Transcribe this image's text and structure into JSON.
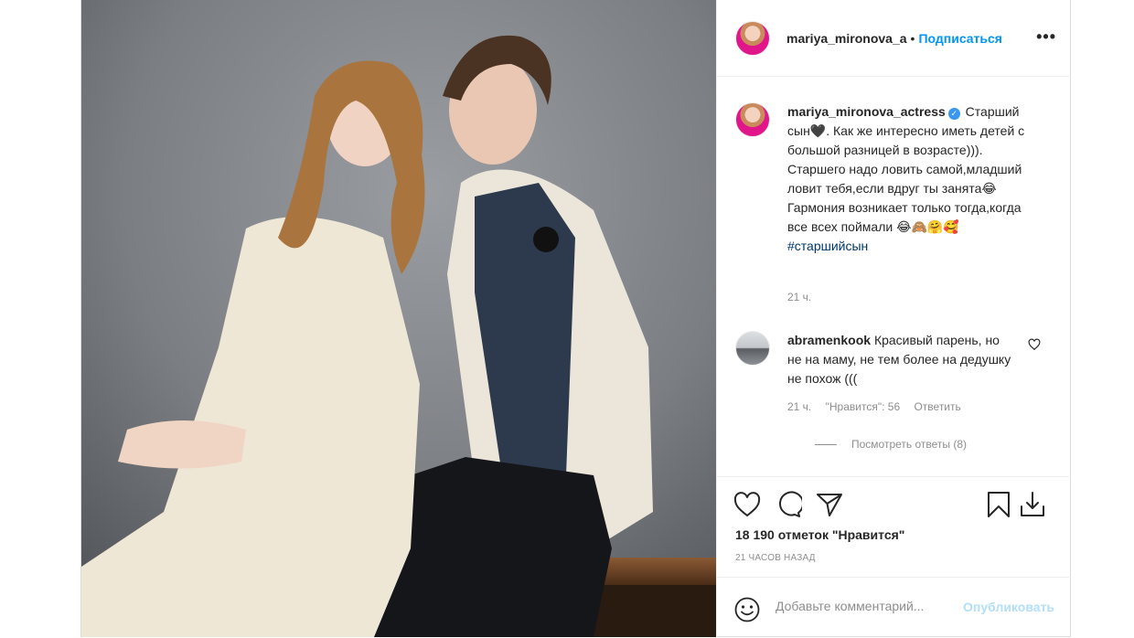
{
  "post": {
    "author": "mariya_mironova_a",
    "follow_label": "Подписаться",
    "separator": "•",
    "more_label": "•••",
    "caption": {
      "username": "mariya_mironova_actress",
      "verified_mark": "✓",
      "text": "Старший сын🖤. Как же интересно иметь детей с большой разницей в возрасте))). Старшего надо ловить самой,младший ловит тебя,если вдруг ты занята😂Гармония возникает только тогда,когда все всех поймали 😂🙈🤗🥰",
      "hashtag": "#старшийсын",
      "time": "21 ч."
    },
    "comment": {
      "username": "abramenkook",
      "text": "Красивый парень, но не на маму, не тем более на дедушку не похож (((",
      "time": "21 ч.",
      "likes": "\"Нравится\": 56",
      "reply_label": "Ответить",
      "view_replies": "Посмотреть ответы (8)"
    },
    "likes_count": "18 190 отметок \"Нравится\"",
    "posted_ago": "21 ЧАСОВ НАЗАД",
    "add_comment": {
      "placeholder": "Добавьте комментарий...",
      "publish_label": "Опубликовать"
    }
  },
  "icons": {
    "like": "heart-icon",
    "comment": "speech-bubble-icon",
    "share": "paper-plane-icon",
    "save": "bookmark-icon",
    "download": "download-icon",
    "emoji": "smiley-icon"
  },
  "colors": {
    "link_blue": "#0095f6",
    "publish_disabled": "#b2dffc",
    "muted_text": "#8e8e8e",
    "hashtag": "#00376b"
  }
}
